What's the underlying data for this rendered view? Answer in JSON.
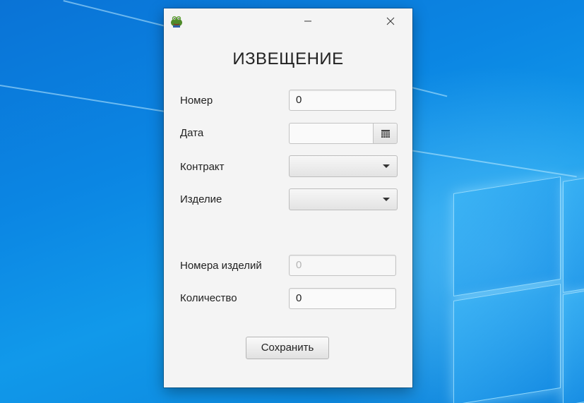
{
  "titlebar": {
    "icon": "frog-app-icon",
    "minimize_icon": "minimize-icon",
    "close_icon": "close-icon"
  },
  "form": {
    "heading": "ИЗВЕЩЕНИЕ",
    "number_label": "Номер",
    "number_value": "0",
    "date_label": "Дата",
    "date_value": "",
    "date_picker_icon": "calendar-icon",
    "contract_label": "Контракт",
    "contract_value": "",
    "product_label": "Изделие",
    "product_value": "",
    "product_numbers_label": "Номера изделий",
    "product_numbers_placeholder": "0",
    "quantity_label": "Количество",
    "quantity_value": "0",
    "save_label": "Сохранить"
  },
  "colors": {
    "desktop": "#0b86e3",
    "window_bg": "#f4f4f4"
  }
}
